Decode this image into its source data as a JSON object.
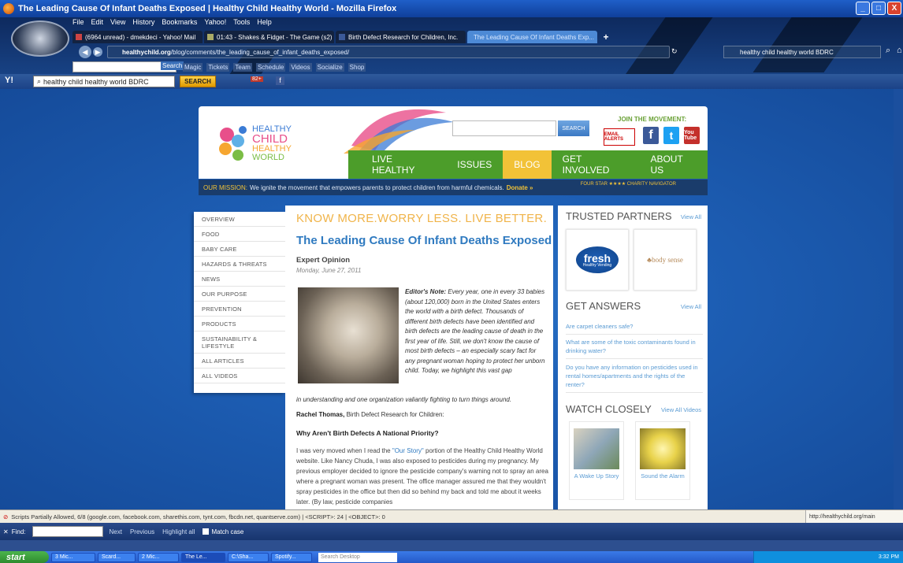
{
  "window": {
    "title": "The Leading Cause Of Infant Deaths Exposed | Healthy Child Healthy World - Mozilla Firefox",
    "minimize": "_",
    "maximize": "□",
    "close": "X"
  },
  "menubar": [
    "File",
    "Edit",
    "View",
    "History",
    "Bookmarks",
    "Yahoo!",
    "Tools",
    "Help"
  ],
  "tabs": [
    {
      "label": "(6964 unread) - dmekdeci - Yahoo! Mail",
      "active": false
    },
    {
      "label": "01:43 - Shakes & Fidget - The Game (s2)",
      "active": false
    },
    {
      "label": "Birth Defect Research for Children, Inc.",
      "active": false
    },
    {
      "label": "The Leading Cause Of Infant Deaths Exp...",
      "active": true
    }
  ],
  "new_tab": "+",
  "url": {
    "domain": "healthychild.org",
    "path": "/blog/comments/the_leading_cause_of_infant_deaths_exposed/"
  },
  "browser_search": "healthy child healthy world BDRC",
  "orlando_toolbar": {
    "search_label": "Search",
    "links": [
      "Magic",
      "Tickets",
      "Team",
      "Schedule",
      "Videos",
      "Socialize",
      "Shop"
    ]
  },
  "yahoo_toolbar": {
    "logo": "Y!",
    "query": "healthy child healthy world BDRC",
    "button": "SEARCH",
    "mail_count": "82+"
  },
  "site": {
    "logo_lines": [
      "HEALTHY",
      "CHILD",
      "HEALTHY",
      "WORLD"
    ],
    "search_button": "SEARCH",
    "join": "JOIN THE MOVEMENT:",
    "email_alerts": "EMAIL ALERTS",
    "nav": [
      "LIVE HEALTHY",
      "ISSUES",
      "BLOG",
      "GET INVOLVED",
      "ABOUT US"
    ],
    "mission_label": "OUR MISSION:",
    "mission_text": "We ignite the movement that empowers parents to protect children from harmful chemicals.",
    "donate": "Donate »",
    "charity": "FOUR STAR ★★★★ CHARITY NAVIGATOR"
  },
  "leftnav": [
    "OVERVIEW",
    "FOOD",
    "BABY CARE",
    "HAZARDS & THREATS",
    "NEWS",
    "OUR PURPOSE",
    "PREVENTION",
    "PRODUCTS",
    "SUSTAINABILITY & LIFESTYLE",
    "ALL ARTICLES",
    "ALL VIDEOS"
  ],
  "article": {
    "slogan": "KNOW MORE.WORRY LESS. LIVE BETTER.",
    "title": "The Leading Cause Of Infant Deaths Exposed",
    "category": "Expert Opinion",
    "date": "Monday, June 27, 2011",
    "editor_label": "Editor's Note:",
    "editor_text": "Every year, one in every 33 babies (about 120,000) born in the United States enters the world with a birth defect. Thousands of different birth defects have been identified and birth defects are the leading cause of death in the first year of life. Still, we don't know the cause of most birth defects – an especially scary fact for any pregnant woman hoping to protect her unborn child. Today, we highlight this vast gap",
    "editor_text2": "in understanding and one organization valiantly fighting to turn things around.",
    "author_name": "Rachel Thomas,",
    "author_org": "Birth Defect Research for Children:",
    "subhead": "Why Aren't Birth Defects A National Priority?",
    "body_1": "I was very moved when I read the",
    "body_link": "\"Our Story\"",
    "body_2": "portion of the Healthy Child Healthy World website. Like Nancy Chuda, I was also exposed to pesticides during my pregnancy. My previous employer decided to ignore the pesticide company's warning not to spray an area where a pregnant woman was present. The office manager assured me that they wouldn't spray pesticides in the office but then did so behind my back and told me about it weeks later. (By law, pesticide companies"
  },
  "sidebar": {
    "partners_title": "TRUSTED PARTNERS",
    "view_all": "View All",
    "fresh": "fresh",
    "fresh_sub": "Healthy Vending",
    "bodysense": "♣body sense",
    "answers_title": "GET ANSWERS",
    "questions": [
      "Are carpet cleaners safe?",
      "What are some of the toxic contaminants found in drinking water?",
      "Do you have any information on pesticides used in rental homes/apartments and the rights of the renter?"
    ],
    "watch_title": "WATCH CLOSELY",
    "view_all_videos": "View All Videos",
    "videos": [
      "A Wake Up Story",
      "Sound the Alarm"
    ]
  },
  "status": {
    "scripts": "Scripts Partially Allowed, 6/8 (google.com, facebook.com, sharethis.com, tynt.com, fbcdn.net, quantserve.com) | <SCRIPT>: 24 | <OBJECT>: 0",
    "url": "http://healthychild.org/main"
  },
  "findbar": {
    "label": "Find:",
    "next": "Next",
    "previous": "Previous",
    "highlight": "Highlight all",
    "match_case": "Match case"
  },
  "taskbar": {
    "start": "start",
    "tasks": [
      "3 Mic...",
      "Scard...",
      "2 Mic...",
      "The Le...",
      "C:\\Sha...",
      "Spotify..."
    ],
    "search_placeholder": "Search Desktop",
    "clock": "3:32 PM"
  },
  "colors": {
    "green_nav": "#4c9d2a",
    "blog_tab": "#f2c237",
    "link": "#2f7ac0",
    "slogan": "#f0b44a"
  }
}
